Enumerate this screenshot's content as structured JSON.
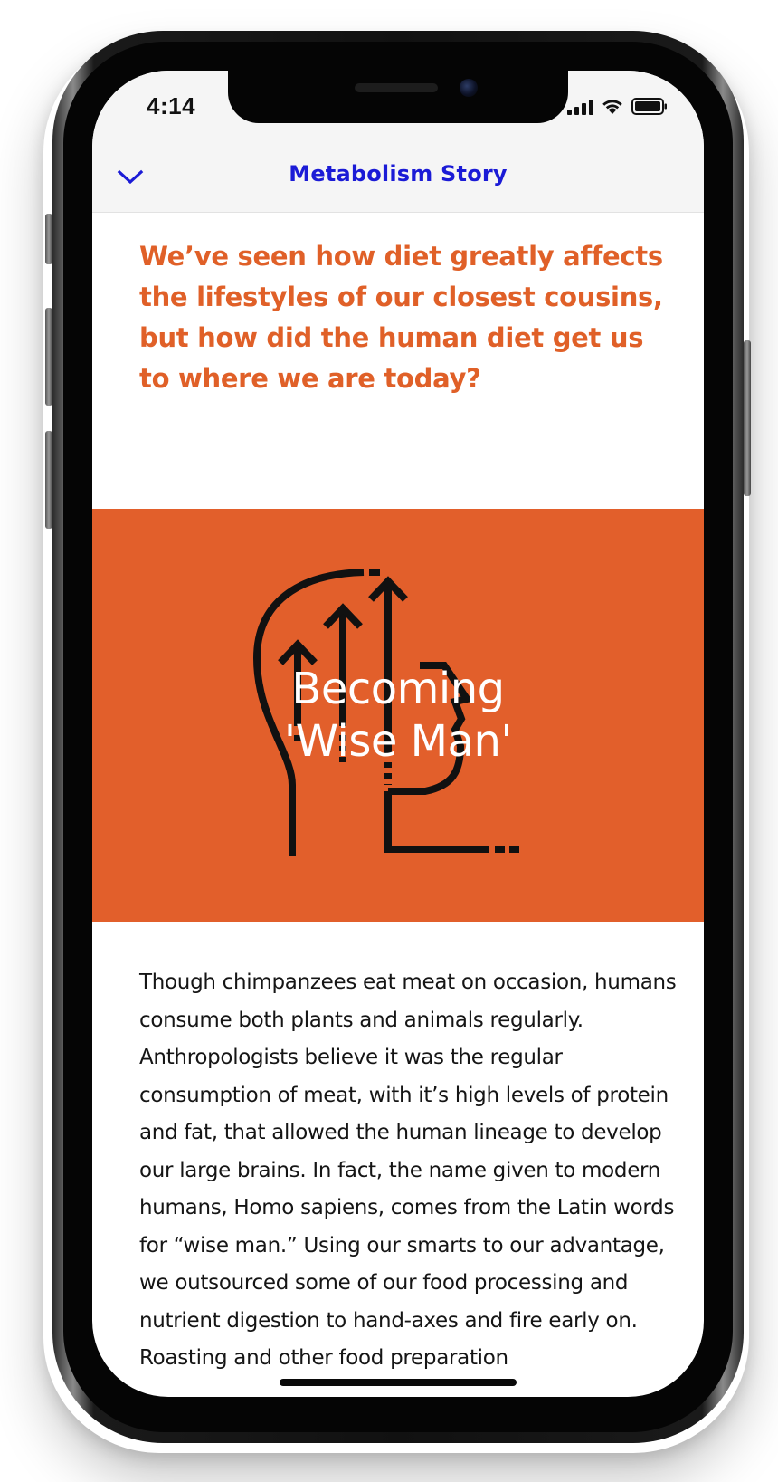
{
  "status_bar": {
    "time": "4:14"
  },
  "nav": {
    "back_icon": "chevron-down-icon",
    "title": "Metabolism Story"
  },
  "intro": {
    "text": "We’ve seen how diet greatly affects the lifestyles of our closest cousins, but how did the human diet get us to where we are today?"
  },
  "hero": {
    "illustration": "head-with-arrows-icon",
    "title_line1": "Becoming",
    "title_line2": "'Wise Man'"
  },
  "body": {
    "text": "Though chimpanzees eat meat on occasion, humans consume both plants and animals regularly. Anthropologists believe it was the regular consumption of meat, with it’s high levels of protein and fat, that allowed the human lineage to develop our large brains. In fact, the name given to modern humans, Homo sapiens, comes from the Latin words for “wise man.” Using our smarts to our advantage, we outsourced some of our food processing and nutrient digestion to hand-axes and fire early on. Roasting and other food preparation"
  },
  "colors": {
    "accent_orange": "#e25f2b",
    "intro_orange": "#e06028",
    "nav_blue": "#1b1bd6",
    "body_text": "#151515"
  }
}
